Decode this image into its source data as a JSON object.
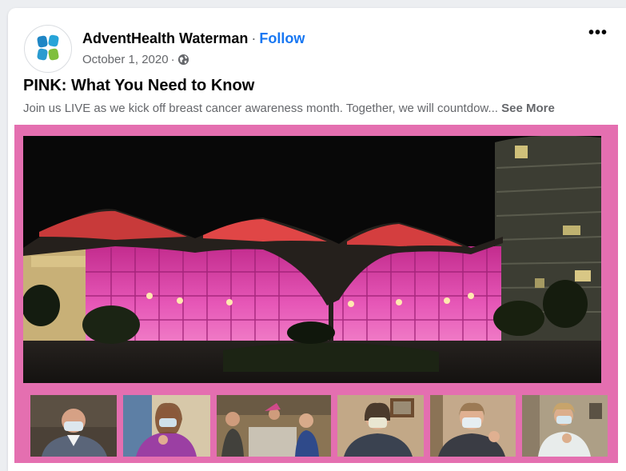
{
  "post": {
    "author": "AdventHealth Waterman",
    "separator": "·",
    "follow_label": "Follow",
    "date": "October 1, 2020",
    "date_separator": "·",
    "privacy_icon": "globe-icon",
    "more_label": "•••",
    "title": "PINK: What You Need to Know",
    "description": "Join us LIVE as we kick off breast cancer awareness month. Together, we will countdow...",
    "see_more_label": "See More"
  },
  "colors": {
    "media_border": "#e46fb0",
    "follow": "#1877f2",
    "logo_blue": "#1f86c5",
    "logo_green": "#7fbf3e"
  },
  "media": {
    "main_photo_icon": "pink-lit-hospital-photo",
    "thumbnail_count": 6
  }
}
